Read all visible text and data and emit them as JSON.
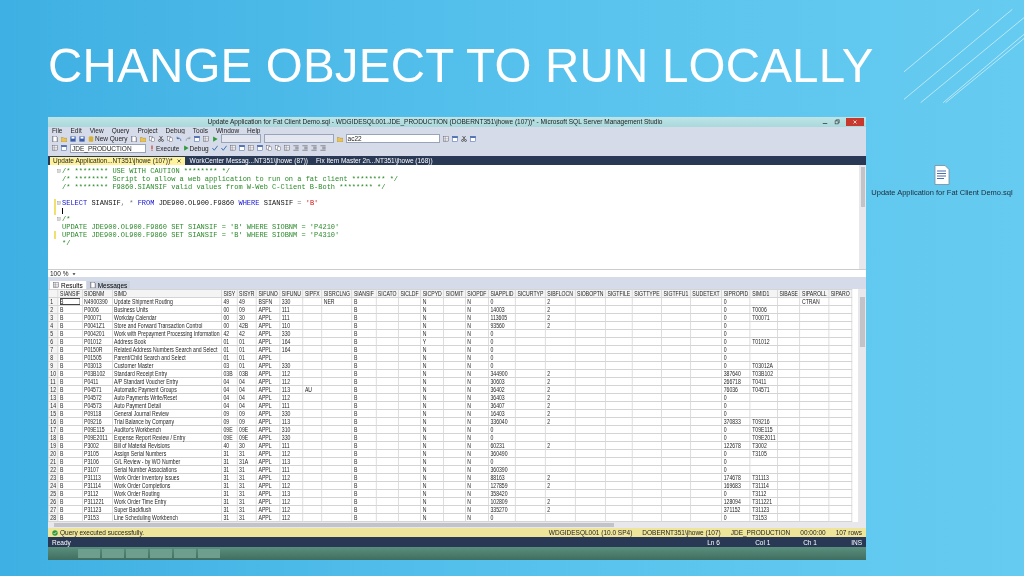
{
  "slide": {
    "title": "CHANGE OBJECT TO RUN LOCALLY"
  },
  "window": {
    "title": "Update Application for Fat Client Demo.sql - WDGIDESQL001.JDE_PRODUCTION (DOBERNT351\\jhowe (107))* - Microsoft SQL Server Management Studio"
  },
  "menu": [
    "File",
    "Edit",
    "View",
    "Query",
    "Project",
    "Debug",
    "Tools",
    "Window",
    "Help"
  ],
  "toolbar_1": {
    "new_query": "New Query",
    "search_combo": "ac22"
  },
  "toolbar_2": {
    "database": "JDE_PRODUCTION",
    "execute": "Execute",
    "debug": "Debug"
  },
  "document_tabs": [
    {
      "label": "Update Application...NT351\\jhowe (107))*",
      "selected": true
    },
    {
      "label": "WorkCenter Messag...NT351\\jhowe (87))",
      "selected": false
    },
    {
      "label": "Fix Item Master 2n...NT351\\jhowe (168))",
      "selected": false
    }
  ],
  "editor": {
    "lines": [
      {
        "kind": "comment",
        "foldable": true,
        "changed": false,
        "text": "/* ******** USE WITH CAUTION ******** */"
      },
      {
        "kind": "comment",
        "foldable": false,
        "changed": false,
        "text": "/* ******** Script to allow a web application to run on a fat client ******** */"
      },
      {
        "kind": "comment",
        "foldable": false,
        "changed": false,
        "text": "/* ******** F9860.SIANSIF valid values from W-Web C-Client B-Both ******** */"
      },
      {
        "kind": "blank",
        "foldable": false,
        "changed": false
      },
      {
        "kind": "code",
        "foldable": true,
        "changed": true,
        "tokens": [
          {
            "kind": "keyword",
            "text": "SELECT"
          },
          {
            "kind": "plain",
            "text": " SIANSIF"
          },
          {
            "kind": "operator",
            "text": ", * "
          },
          {
            "kind": "keyword",
            "text": "FROM"
          },
          {
            "kind": "plain",
            "text": " JDE900.OL900.F9860 "
          },
          {
            "kind": "keyword",
            "text": "WHERE"
          },
          {
            "kind": "plain",
            "text": " SIANSIF "
          },
          {
            "kind": "operator",
            "text": "= "
          },
          {
            "kind": "string",
            "text": "'B'"
          }
        ]
      },
      {
        "kind": "cursor",
        "foldable": false,
        "changed": true
      },
      {
        "kind": "comment",
        "foldable": true,
        "changed": false,
        "text": "/*"
      },
      {
        "kind": "comment",
        "foldable": false,
        "changed": false,
        "text": "UPDATE JDE900.OL900.F9860 SET SIANSIF = 'B' WHERE SIOBNM = 'P4210'"
      },
      {
        "kind": "comment",
        "foldable": false,
        "changed": true,
        "text": "UPDATE JDE900.OL900.F9860 SET SIANSIF = 'B' WHERE SIOBNM = 'P4310'"
      },
      {
        "kind": "comment",
        "foldable": false,
        "changed": false,
        "text": "*/"
      }
    ]
  },
  "zoom": "100 %",
  "results_tabs": [
    {
      "label": "Results",
      "selected": true
    },
    {
      "label": "Messages",
      "selected": false
    }
  ],
  "grid": {
    "columns": [
      "SIANSIF",
      "SIOBNM",
      "SIMD",
      "SISY",
      "SISYR",
      "SIFUNO",
      "SIFUNU",
      "SIPFX",
      "SISRCLNG",
      "SIANSIF",
      "SICATO",
      "SICLDF",
      "SICPYD",
      "SIOMIT",
      "SIOPDF",
      "SIAPPLID",
      "SICURTYP",
      "SIBFLOCN",
      "SIOBOPTN",
      "SIGTFILE",
      "SIGTTYPE",
      "SIGTFFU1",
      "SUDETEXT",
      "SIPROPID",
      "SIMID1",
      "SIBASE",
      "SIPAROLL",
      "SIPARO"
    ],
    "rows": [
      {
        "number": "1",
        "selected": true,
        "cells": [
          "B",
          "N4900390",
          "Update Shipment Routing",
          "49",
          "49",
          "BSFN",
          "330",
          null,
          "NER",
          "B",
          null,
          null,
          "N",
          null,
          "N",
          "0",
          null,
          "2",
          null,
          null,
          null,
          null,
          null,
          "0",
          null,
          null,
          "CTRAN",
          null
        ]
      },
      {
        "number": "2",
        "selected": false,
        "cells": [
          "B",
          "P0006",
          "Business Units",
          "00",
          "09",
          "APPL",
          "111",
          null,
          null,
          "B",
          null,
          null,
          "N",
          null,
          "N",
          "14003",
          null,
          "2",
          null,
          null,
          null,
          null,
          null,
          "0",
          "T0006",
          null,
          null,
          null
        ]
      },
      {
        "number": "3",
        "selected": false,
        "cells": [
          "B",
          "P00071",
          "Workday Calendar",
          "00",
          "30",
          "APPL",
          "111",
          null,
          null,
          "B",
          null,
          null,
          "N",
          null,
          "N",
          "113605",
          null,
          "2",
          null,
          null,
          null,
          null,
          null,
          "0",
          "T00071",
          null,
          null,
          null
        ]
      },
      {
        "number": "4",
        "selected": false,
        "cells": [
          "B",
          "P0041Z1",
          "Store and Forward Transaction Control",
          "00",
          "42B",
          "APPL",
          "110",
          null,
          null,
          "B",
          null,
          null,
          "N",
          null,
          "N",
          "93560",
          null,
          "2",
          null,
          null,
          null,
          null,
          null,
          "0",
          null,
          null,
          null,
          null
        ]
      },
      {
        "number": "5",
        "selected": false,
        "cells": [
          "B",
          "P004201",
          "Work with Prepayment Processing Information",
          "42",
          "42",
          "APPL",
          "330",
          null,
          null,
          "B",
          null,
          null,
          "N",
          null,
          "N",
          "0",
          null,
          null,
          null,
          null,
          null,
          null,
          null,
          "0",
          null,
          null,
          null,
          null
        ]
      },
      {
        "number": "6",
        "selected": false,
        "cells": [
          "B",
          "P01012",
          "Address Book",
          "01",
          "01",
          "APPL",
          "164",
          null,
          null,
          "B",
          null,
          null,
          "Y",
          null,
          "N",
          "0",
          null,
          null,
          null,
          null,
          null,
          null,
          null,
          "0",
          "T01012",
          null,
          null,
          null
        ]
      },
      {
        "number": "7",
        "selected": false,
        "cells": [
          "B",
          "P0150R",
          "Related Address Numbers Search and Select",
          "01",
          "01",
          "APPL",
          "164",
          null,
          null,
          "B",
          null,
          null,
          "N",
          null,
          "N",
          "0",
          null,
          null,
          null,
          null,
          null,
          null,
          null,
          "0",
          null,
          null,
          null,
          null
        ]
      },
      {
        "number": "8",
        "selected": false,
        "cells": [
          "B",
          "P01505",
          "Parent/Child Search and Select",
          "01",
          "01",
          "APPL",
          null,
          null,
          null,
          "B",
          null,
          null,
          "N",
          null,
          "N",
          "0",
          null,
          null,
          null,
          null,
          null,
          null,
          null,
          "0",
          null,
          null,
          null,
          null
        ]
      },
      {
        "number": "9",
        "selected": false,
        "cells": [
          "B",
          "P03013",
          "Customer Master",
          "03",
          "01",
          "APPL",
          "330",
          null,
          null,
          "B",
          null,
          null,
          "N",
          null,
          "N",
          "0",
          null,
          null,
          null,
          null,
          null,
          null,
          null,
          "0",
          "T03012A",
          null,
          null,
          null
        ]
      },
      {
        "number": "10",
        "selected": false,
        "cells": [
          "B",
          "P03B102",
          "Standard Receipt Entry",
          "03B",
          "03B",
          "APPL",
          "112",
          null,
          null,
          "B",
          null,
          null,
          "N",
          null,
          "N",
          "344900",
          null,
          "2",
          null,
          null,
          null,
          null,
          null,
          "387640",
          "T03B102",
          null,
          null,
          null
        ]
      },
      {
        "number": "11",
        "selected": false,
        "cells": [
          "B",
          "P0411",
          "A/P Standard Voucher Entry",
          "04",
          "04",
          "APPL",
          "112",
          null,
          null,
          "B",
          null,
          null,
          "N",
          null,
          "N",
          "30603",
          null,
          "2",
          null,
          null,
          null,
          null,
          null,
          "266718",
          "T0411",
          null,
          null,
          null
        ]
      },
      {
        "number": "12",
        "selected": false,
        "cells": [
          "B",
          "P04571",
          "Automatic Payment Groups",
          "04",
          "04",
          "APPL",
          "113",
          "AU",
          null,
          "B",
          null,
          null,
          "N",
          null,
          "N",
          "36402",
          null,
          "2",
          null,
          null,
          null,
          null,
          null,
          "76036",
          "T04571",
          null,
          null,
          null
        ]
      },
      {
        "number": "13",
        "selected": false,
        "cells": [
          "B",
          "P04572",
          "Auto Payments Write/Reset",
          "04",
          "04",
          "APPL",
          "112",
          null,
          null,
          "B",
          null,
          null,
          "N",
          null,
          "N",
          "36403",
          null,
          "2",
          null,
          null,
          null,
          null,
          null,
          "0",
          null,
          null,
          null,
          null
        ]
      },
      {
        "number": "14",
        "selected": false,
        "cells": [
          "B",
          "P04573",
          "Auto Payment Detail",
          "04",
          "04",
          "APPL",
          "111",
          null,
          null,
          "B",
          null,
          null,
          "N",
          null,
          "N",
          "36407",
          null,
          "2",
          null,
          null,
          null,
          null,
          null,
          "0",
          null,
          null,
          null,
          null
        ]
      },
      {
        "number": "15",
        "selected": false,
        "cells": [
          "B",
          "P09118",
          "General Journal Review",
          "09",
          "09",
          "APPL",
          "330",
          null,
          null,
          "B",
          null,
          null,
          "N",
          null,
          "N",
          "16403",
          null,
          "2",
          null,
          null,
          null,
          null,
          null,
          "0",
          null,
          null,
          null,
          null
        ]
      },
      {
        "number": "16",
        "selected": false,
        "cells": [
          "B",
          "P09216",
          "Trial Balance by Company",
          "09",
          "09",
          "APPL",
          "113",
          null,
          null,
          "B",
          null,
          null,
          "N",
          null,
          "N",
          "336040",
          null,
          "2",
          null,
          null,
          null,
          null,
          null,
          "370833",
          "T09216",
          null,
          null,
          null
        ]
      },
      {
        "number": "17",
        "selected": false,
        "cells": [
          "B",
          "P09E115",
          "Auditor's Workbench",
          "09E",
          "09E",
          "APPL",
          "310",
          null,
          null,
          "B",
          null,
          null,
          "N",
          null,
          "N",
          "0",
          null,
          null,
          null,
          null,
          null,
          null,
          null,
          "0",
          "T09E115",
          null,
          null,
          null
        ]
      },
      {
        "number": "18",
        "selected": false,
        "cells": [
          "B",
          "P09E2011",
          "Expense Report Review / Entry",
          "09E",
          "09E",
          "APPL",
          "330",
          null,
          null,
          "B",
          null,
          null,
          "N",
          null,
          "N",
          "0",
          null,
          null,
          null,
          null,
          null,
          null,
          null,
          "0",
          "T09E2011",
          null,
          null,
          null
        ]
      },
      {
        "number": "19",
        "selected": false,
        "cells": [
          "B",
          "P3002",
          "Bill of Material Revisions",
          "40",
          "30",
          "APPL",
          "111",
          null,
          null,
          "B",
          null,
          null,
          "N",
          null,
          "N",
          "60231",
          null,
          "2",
          null,
          null,
          null,
          null,
          null,
          "122678",
          "T3002",
          null,
          null,
          null
        ]
      },
      {
        "number": "20",
        "selected": false,
        "cells": [
          "B",
          "P3105",
          "Assign Serial Numbers",
          "31",
          "31",
          "APPL",
          "112",
          null,
          null,
          "B",
          null,
          null,
          "N",
          null,
          "N",
          "360490",
          null,
          null,
          null,
          null,
          null,
          null,
          null,
          "0",
          "T3105",
          null,
          null,
          null
        ]
      },
      {
        "number": "21",
        "selected": false,
        "cells": [
          "B",
          "P3106",
          "G/L Review - by WO Number",
          "31",
          "31A",
          "APPL",
          "113",
          null,
          null,
          "B",
          null,
          null,
          "N",
          null,
          "N",
          "0",
          null,
          null,
          null,
          null,
          null,
          null,
          null,
          "0",
          null,
          null,
          null,
          null
        ]
      },
      {
        "number": "22",
        "selected": false,
        "cells": [
          "B",
          "P3107",
          "Serial Number Associations",
          "31",
          "31",
          "APPL",
          "111",
          null,
          null,
          "B",
          null,
          null,
          "N",
          null,
          "N",
          "360390",
          null,
          null,
          null,
          null,
          null,
          null,
          null,
          "0",
          null,
          null,
          null,
          null
        ]
      },
      {
        "number": "23",
        "selected": false,
        "cells": [
          "B",
          "P31113",
          "Work Order Inventory Issues",
          "31",
          "31",
          "APPL",
          "112",
          null,
          null,
          "B",
          null,
          null,
          "N",
          null,
          "N",
          "88163",
          null,
          "2",
          null,
          null,
          null,
          null,
          null,
          "174678",
          "T31113",
          null,
          null,
          null
        ]
      },
      {
        "number": "24",
        "selected": false,
        "cells": [
          "B",
          "P31114",
          "Work Order Completions",
          "31",
          "31",
          "APPL",
          "112",
          null,
          null,
          "B",
          null,
          null,
          "N",
          null,
          "N",
          "127859",
          null,
          "2",
          null,
          null,
          null,
          null,
          null,
          "169683",
          "T31114",
          null,
          null,
          null
        ]
      },
      {
        "number": "25",
        "selected": false,
        "cells": [
          "B",
          "P3112",
          "Work Order Routing",
          "31",
          "31",
          "APPL",
          "113",
          null,
          null,
          "B",
          null,
          null,
          "N",
          null,
          "N",
          "358420",
          null,
          null,
          null,
          null,
          null,
          null,
          null,
          "0",
          "T3112",
          null,
          null,
          null
        ]
      },
      {
        "number": "26",
        "selected": false,
        "cells": [
          "B",
          "P311221",
          "Work Order Time Entry",
          "31",
          "31",
          "APPL",
          "112",
          null,
          null,
          "B",
          null,
          null,
          "N",
          null,
          "N",
          "102809",
          null,
          "2",
          null,
          null,
          null,
          null,
          null,
          "128094",
          "T311221",
          null,
          null,
          null
        ]
      },
      {
        "number": "27",
        "selected": false,
        "cells": [
          "B",
          "P31123",
          "Super Backflush",
          "31",
          "31",
          "APPL",
          "112",
          null,
          null,
          "B",
          null,
          null,
          "N",
          null,
          "N",
          "335270",
          null,
          "2",
          null,
          null,
          null,
          null,
          null,
          "371152",
          "T31123",
          null,
          null,
          null
        ]
      },
      {
        "number": "28",
        "selected": false,
        "cells": [
          "B",
          "P3153",
          "Line Scheduling Workbench",
          "31",
          "31",
          "APPL",
          "112",
          null,
          null,
          "B",
          null,
          null,
          "N",
          null,
          "N",
          "0",
          null,
          null,
          null,
          null,
          null,
          null,
          null,
          "0",
          "T3153",
          null,
          null,
          null
        ]
      }
    ]
  },
  "query_status": {
    "message": "Query executed successfully.",
    "server": "WDGIDESQL001 (10.0 SP4)",
    "user": "DOBERNT351\\jhowe (107)",
    "database": "JDE_PRODUCTION",
    "elapsed": "00:00:00",
    "rows": "107 rows"
  },
  "status_bar": {
    "state": "Ready",
    "line": "Ln 6",
    "column": "Col 1",
    "char": "Ch 1",
    "mode": "INS"
  },
  "desktop_file": {
    "label": "Update Application for Fat Client Demo.sql"
  }
}
